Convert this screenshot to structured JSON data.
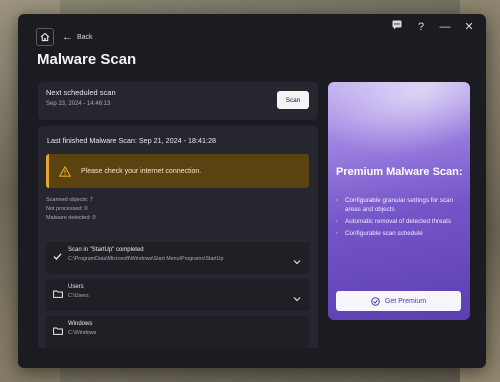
{
  "nav": {
    "back_label": "Back"
  },
  "page": {
    "title": "Malware Scan"
  },
  "schedule": {
    "label": "Next scheduled scan",
    "datetime": "Sep 23, 2024 - 14:46:13",
    "scan_button": "Scan"
  },
  "results": {
    "last_finished": "Last finished Malware Scan: Sep 21, 2024 - 18:41:28",
    "warning": "Please check your internet connection.",
    "stats": [
      "Scanned objects: 7",
      "Not processed: 0",
      "Malware detected: 0"
    ],
    "items": [
      {
        "name": "Scan in \"StartUp\" completed",
        "path": "C:\\ProgramData\\Microsoft\\Windows\\Start Menu\\Programs\\StartUp",
        "icon": "check-icon"
      },
      {
        "name": "Users",
        "path": "C:\\Users",
        "icon": "folder-icon"
      },
      {
        "name": "Windows",
        "path": "C:\\Windows",
        "icon": "folder-icon"
      }
    ]
  },
  "premium": {
    "title": "Premium Malware Scan:",
    "features": [
      "Configurable granular settings for scan areas and objects",
      "Automatic removal of detected threats",
      "Configurable scan schedule"
    ],
    "button": "Get Premium"
  },
  "colors": {
    "accent": "#7455c7",
    "warning": "#e6a623",
    "window": "#1b1c22"
  }
}
